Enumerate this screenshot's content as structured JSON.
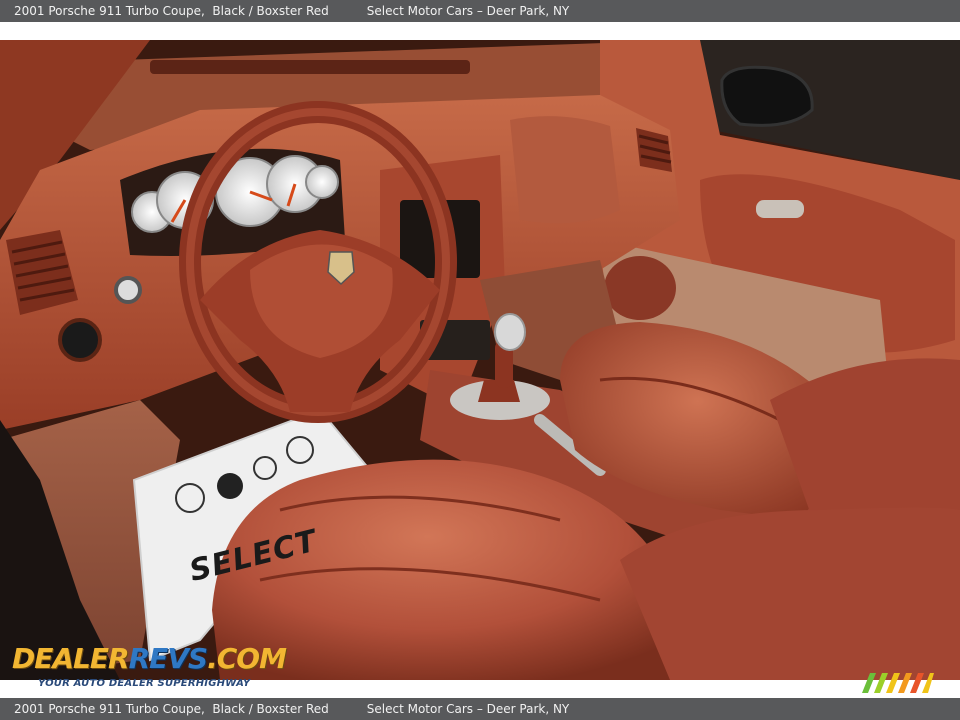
{
  "caption": {
    "vehicle": "2001 Porsche 911 Turbo Coupe,",
    "colors": "Black / Boxster Red",
    "dealer": "Select Motor Cars – Deer Park, NY"
  },
  "photo": {
    "floor_mat_text": "SELECT"
  },
  "watermark": {
    "logo_part1": "DEALER",
    "logo_part2": "REVS",
    "logo_part3": ".COM",
    "tagline": "YOUR AUTO DEALER SUPERHIGHWAY"
  },
  "palette": {
    "leather": "#b8553a",
    "leather_dark": "#7e2f1e",
    "leather_light": "#d9795a",
    "caption_bar": "#58595b"
  }
}
